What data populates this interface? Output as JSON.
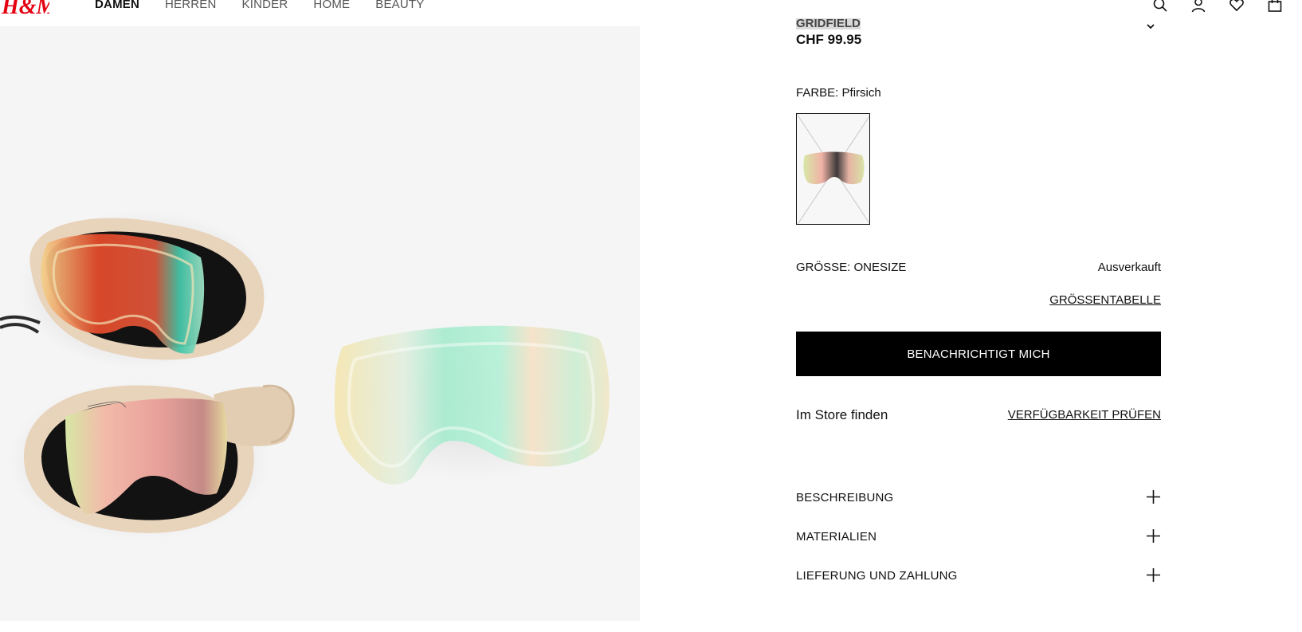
{
  "header": {
    "logo": "H&M",
    "nav": [
      {
        "label": "DAMEN",
        "active": true
      },
      {
        "label": "HERREN",
        "active": false
      },
      {
        "label": "KINDER",
        "active": false
      },
      {
        "label": "HOME",
        "active": false
      },
      {
        "label": "BEAUTY",
        "active": false
      }
    ],
    "icons": [
      "search-icon",
      "account-icon",
      "favorites-icon",
      "shopping-bag-icon"
    ],
    "brand_color": "#e50010"
  },
  "product": {
    "variant_selected": "GRIDFIELD",
    "price": "CHF 99.95",
    "color_label": "FARBE:",
    "color_value": "Pfirsich",
    "size_label": "GRÖSSE: ONESIZE",
    "availability": "Ausverkauft",
    "size_chart_link": "GRÖSSENTABELLE",
    "notify_button": "BENACHRICHTIGT MICH",
    "store_label": "Im Store finden",
    "store_link": "VERFÜGBARKEIT PRÜFEN",
    "accordion": [
      {
        "label": "BESCHREIBUNG",
        "icon": "plus-icon"
      },
      {
        "label": "MATERIALIEN",
        "icon": "plus-icon"
      },
      {
        "label": "LIEFERUNG UND ZAHLUNG",
        "icon": "plus-icon"
      }
    ]
  }
}
